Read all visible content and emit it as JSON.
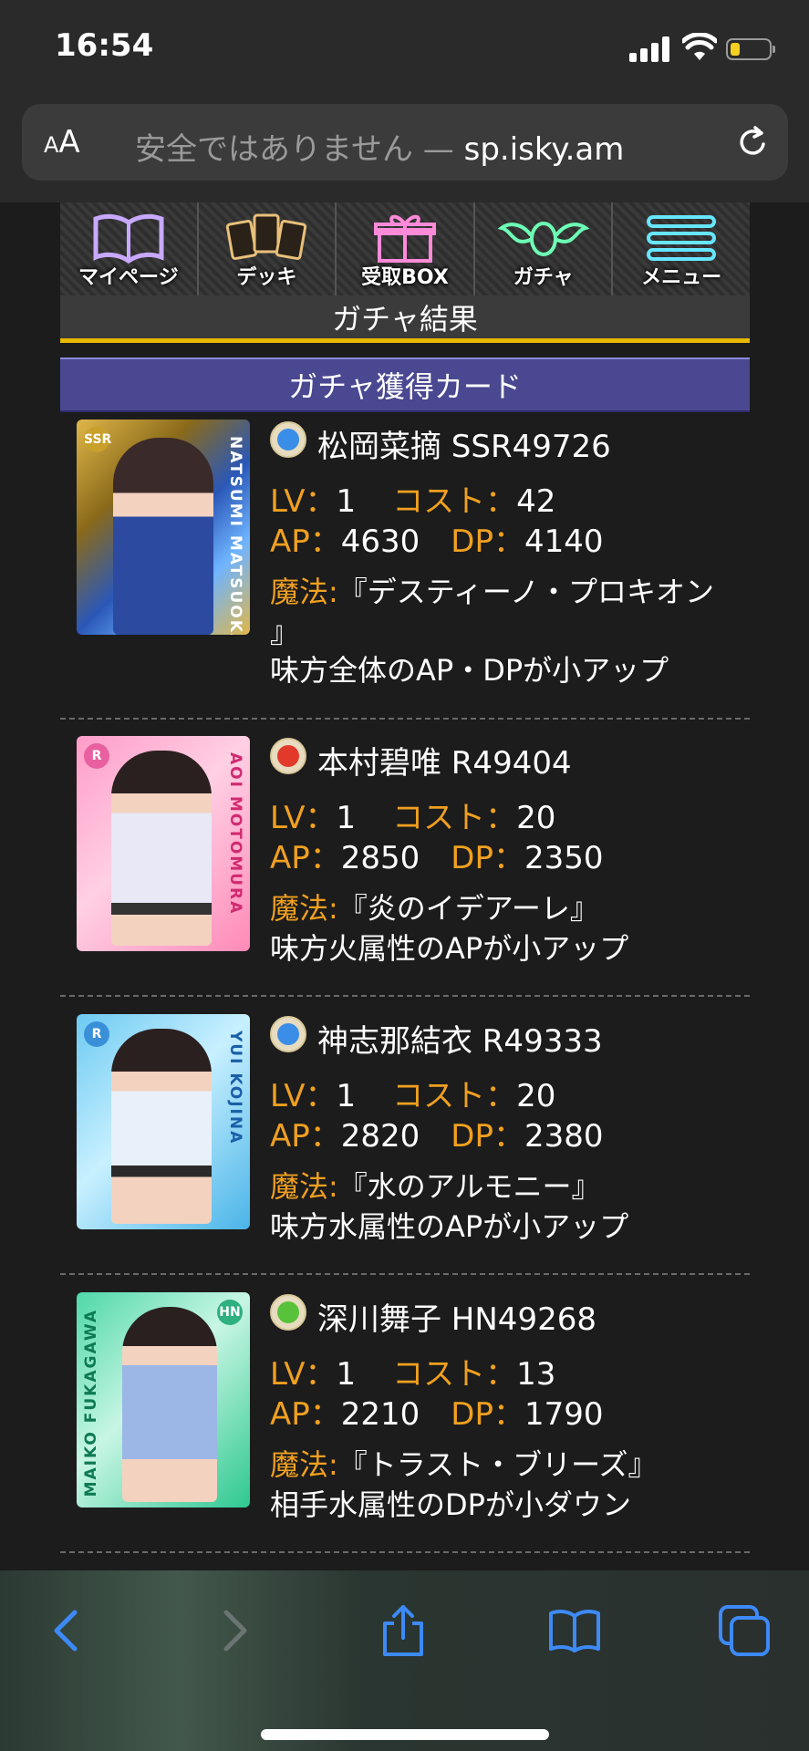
{
  "status": {
    "time": "16:54",
    "battery_level": 0.25
  },
  "browser": {
    "aa_label_small": "A",
    "aa_label_big": "A",
    "url_insecure": "安全ではありません",
    "url_dash": "—",
    "url_domain": "sp.isky.am"
  },
  "nav": {
    "items": [
      {
        "label": "マイページ",
        "icon": "book-icon"
      },
      {
        "label": "デッキ",
        "icon": "cards-icon"
      },
      {
        "label": "受取BOX",
        "icon": "gift-icon"
      },
      {
        "label": "ガチャ",
        "icon": "winged-egg-icon"
      },
      {
        "label": "メニュー",
        "icon": "menu-icon"
      }
    ]
  },
  "page_title": "ガチャ結果",
  "section_title": "ガチャ獲得カード",
  "labels": {
    "lv": "LV：",
    "cost": "コスト：",
    "ap": "AP：",
    "dp": "DP：",
    "magic": "魔法:"
  },
  "cards": [
    {
      "element": "water",
      "name": "松岡菜摘 SSR49726",
      "lv": "1",
      "cost": "42",
      "ap": "4630",
      "dp": "4140",
      "magic_line1": "『デスティーノ・プロキオン",
      "magic_line2": "』",
      "effect": "味方全体のAP・DPが小アップ",
      "rarity_badge": "SSR",
      "vertical_name": "NATSUMI MATSUOKA"
    },
    {
      "element": "fire",
      "name": "本村碧唯 R49404",
      "lv": "1",
      "cost": "20",
      "ap": "2850",
      "dp": "2350",
      "magic_line1": "『炎のイデアーレ』",
      "effect": "味方火属性のAPが小アップ",
      "rarity_badge": "R",
      "vertical_name": "AOI MOTOMURA"
    },
    {
      "element": "water",
      "name": "神志那結衣 R49333",
      "lv": "1",
      "cost": "20",
      "ap": "2820",
      "dp": "2380",
      "magic_line1": "『水のアルモニー』",
      "effect": "味方水属性のAPが小アップ",
      "rarity_badge": "R",
      "vertical_name": "YUI KOJINA"
    },
    {
      "element": "wind",
      "name": "深川舞子 HN49268",
      "lv": "1",
      "cost": "13",
      "ap": "2210",
      "dp": "1790",
      "magic_line1": "『トラスト・ブリーズ』",
      "effect": "相手水属性のDPが小ダウン",
      "rarity_badge": "HN",
      "vertical_name": "MAIKO FUKAGAWA"
    }
  ],
  "colors": {
    "label_orange": "#f0a020",
    "section_purple": "#4a4891",
    "title_underline": "#e8b800",
    "ios_blue": "#3d8af7"
  }
}
